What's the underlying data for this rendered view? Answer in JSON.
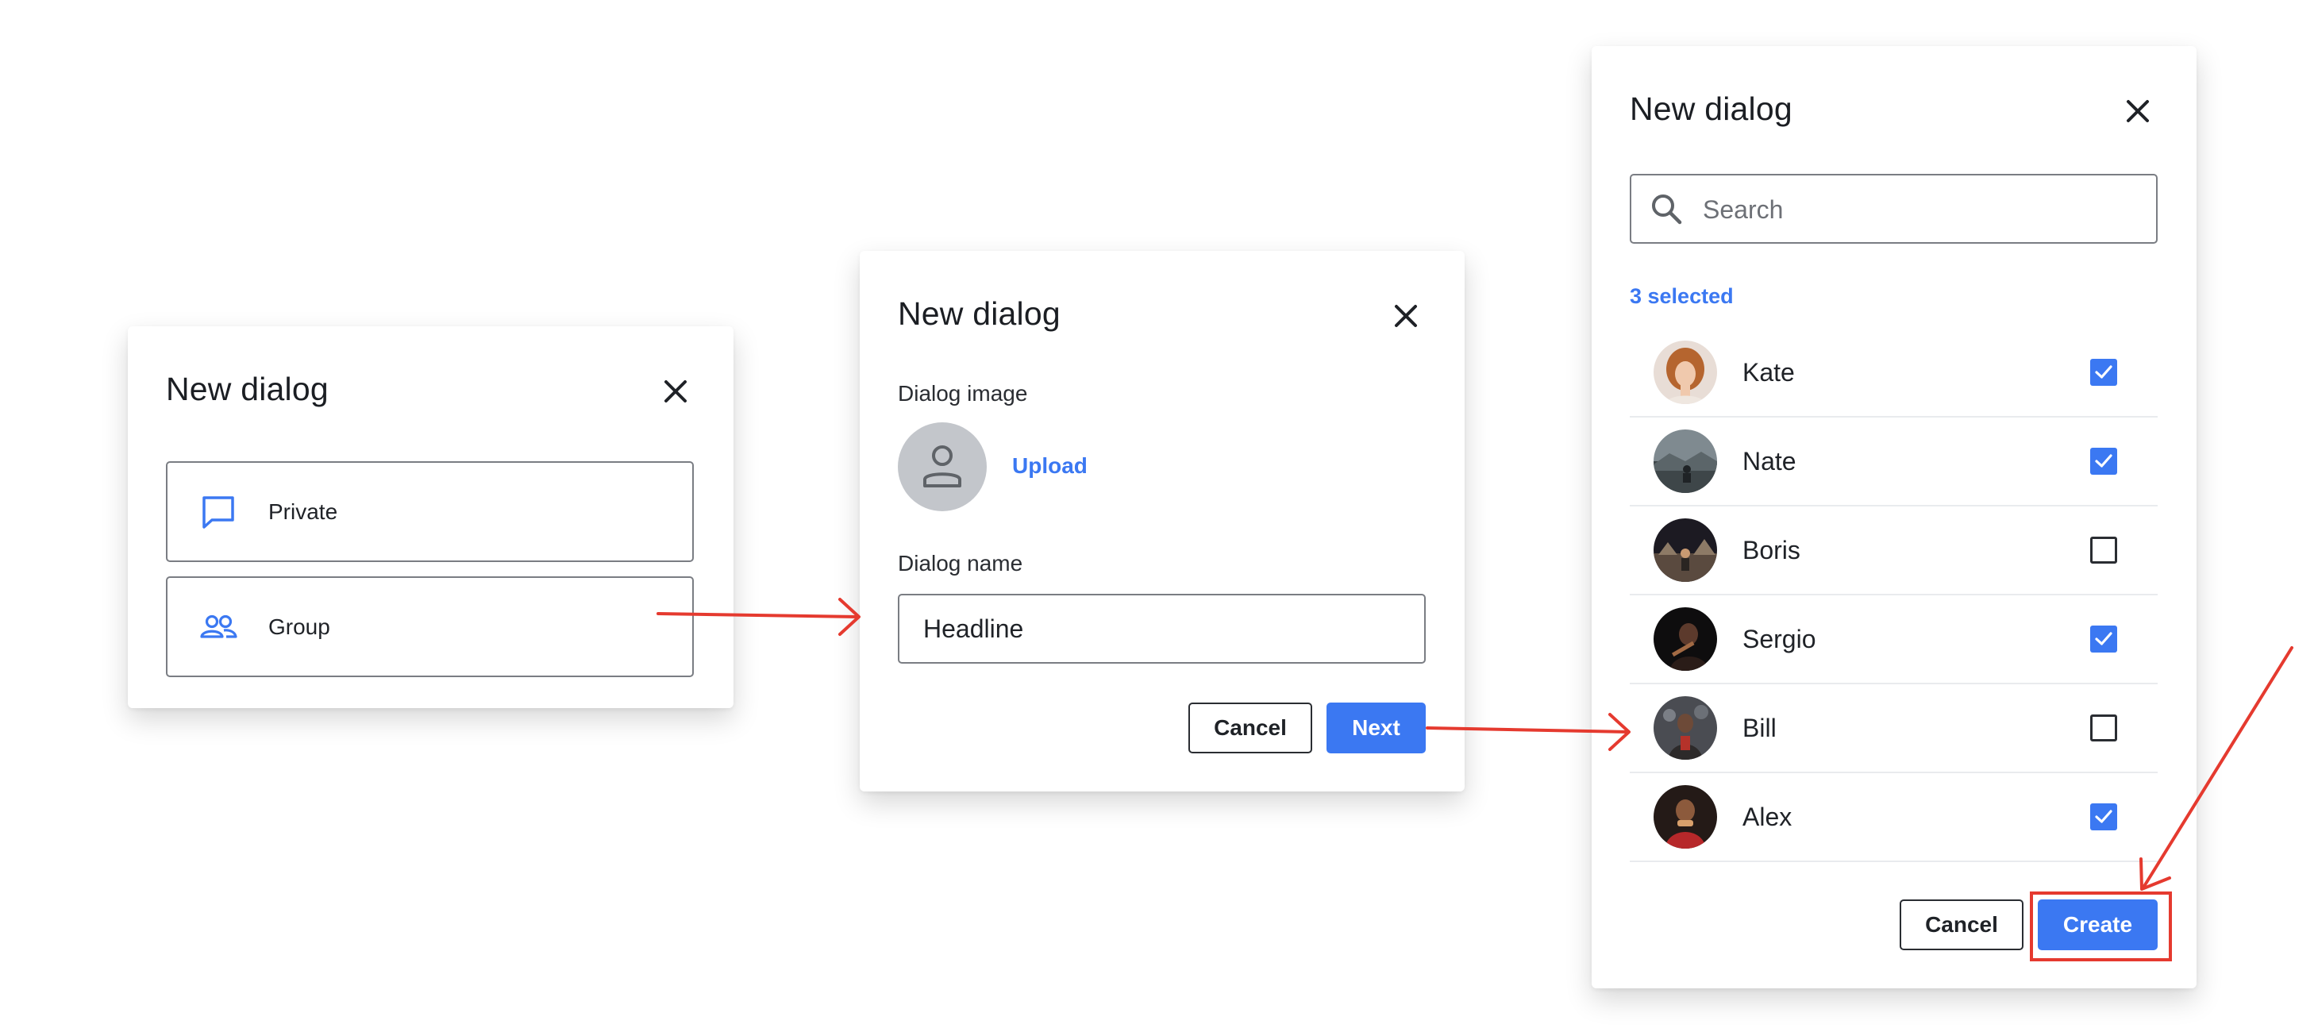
{
  "colors": {
    "accent": "#3b78f2",
    "annotation": "#e53a2f"
  },
  "step1": {
    "title": "New dialog",
    "options": [
      {
        "label": "Private",
        "icon": "chat-bubble-icon"
      },
      {
        "label": "Group",
        "icon": "group-icon"
      }
    ]
  },
  "step2": {
    "title": "New dialog",
    "image_label": "Dialog image",
    "upload_label": "Upload",
    "name_label": "Dialog name",
    "name_value": "Headline",
    "cancel_label": "Cancel",
    "next_label": "Next"
  },
  "step3": {
    "title": "New dialog",
    "search_placeholder": "Search",
    "selected_text": "3 selected",
    "contacts": [
      {
        "name": "Kate",
        "checked": true
      },
      {
        "name": "Nate",
        "checked": true
      },
      {
        "name": "Boris",
        "checked": false
      },
      {
        "name": "Sergio",
        "checked": true
      },
      {
        "name": "Bill",
        "checked": false
      },
      {
        "name": "Alex",
        "checked": true
      }
    ],
    "cancel_label": "Cancel",
    "create_label": "Create"
  }
}
